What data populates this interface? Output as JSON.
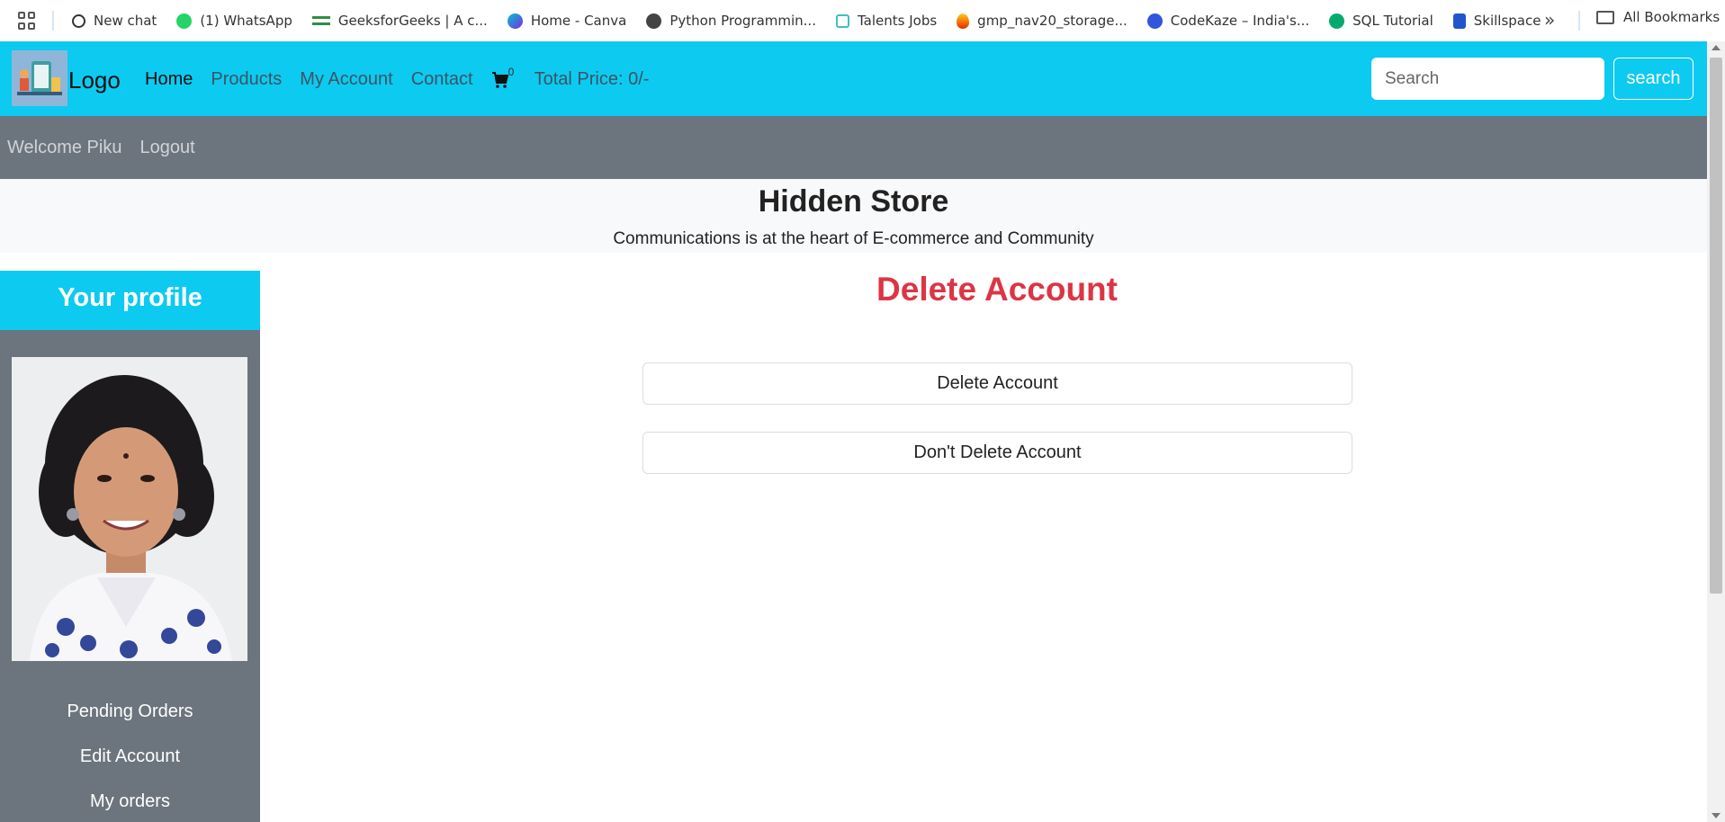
{
  "bookmarks": {
    "items": [
      {
        "label": "New chat",
        "icon": "openai-icon",
        "color": "#222222"
      },
      {
        "label": "(1) WhatsApp",
        "icon": "whatsapp-icon",
        "color": "#25d366"
      },
      {
        "label": "GeeksforGeeks | A c...",
        "icon": "geeksforgeeks-icon",
        "color": "#2f8d46"
      },
      {
        "label": "Home - Canva",
        "icon": "canva-icon",
        "color": "#7d2ae8"
      },
      {
        "label": "Python Programmin...",
        "icon": "globe-icon",
        "color": "#444444"
      },
      {
        "label": "Talents Jobs",
        "icon": "talents-icon",
        "color": "#3fbfbf"
      },
      {
        "label": "gmp_nav20_storage...",
        "icon": "firebase-icon",
        "color": "#f57c00"
      },
      {
        "label": "CodeKaze – India's...",
        "icon": "codekaze-icon",
        "color": "#3355dd"
      },
      {
        "label": "SQL Tutorial",
        "icon": "w3schools-icon",
        "color": "#04aa6d"
      },
      {
        "label": "Skillspace",
        "icon": "skillspace-icon",
        "color": "#2255cc"
      }
    ],
    "all_bookmarks": "All Bookmarks"
  },
  "navbar": {
    "logo": "Logo",
    "links": [
      "Home",
      "Products",
      "My Account",
      "Contact"
    ],
    "cart_count": "0",
    "total_price": "Total Price: 0/-",
    "search_placeholder": "Search",
    "search_button": "search",
    "accent": "#0dcaf0"
  },
  "subnav": {
    "welcome": "Welcome Piku",
    "logout": "Logout"
  },
  "hero": {
    "title": "Hidden Store",
    "subtitle": "Communications is at the heart of E-commerce and Community"
  },
  "sidebar": {
    "heading": "Your profile",
    "items": [
      "Pending Orders",
      "Edit Account",
      "My orders"
    ]
  },
  "main": {
    "title": "Delete Account",
    "title_color": "#dc3545",
    "delete_button": "Delete Account",
    "keep_button": "Don't Delete Account"
  }
}
